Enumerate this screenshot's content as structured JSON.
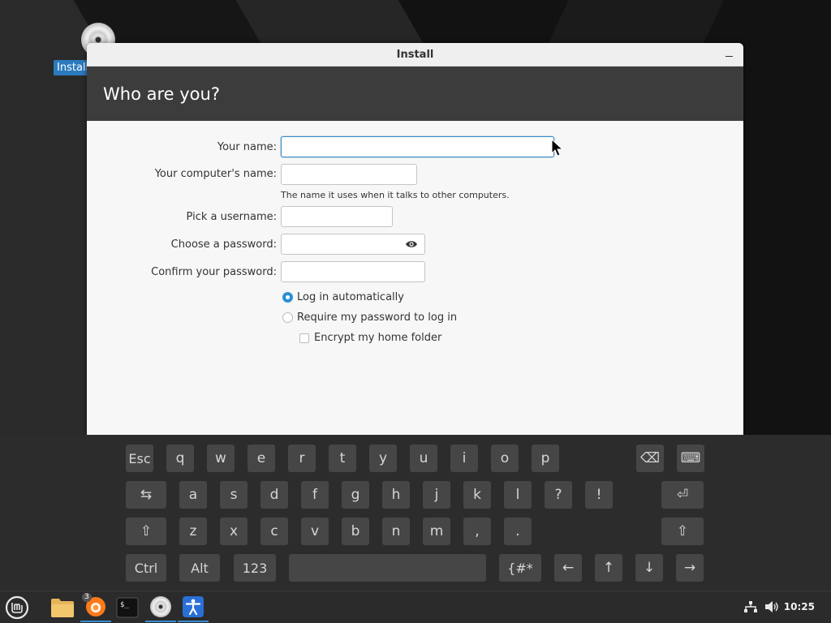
{
  "desktop": {
    "icon_label": "Install"
  },
  "window": {
    "title": "Install",
    "heading": "Who are you?"
  },
  "form": {
    "name_label": "Your name:",
    "name_value": "",
    "computer_label": "Your computer's name:",
    "computer_value": "",
    "computer_hint": "The name it uses when it talks to other computers.",
    "username_label": "Pick a username:",
    "username_value": "",
    "password_label": "Choose a password:",
    "password_value": "",
    "confirm_label": "Confirm your password:",
    "confirm_value": "",
    "login_auto_label": "Log in automatically",
    "login_auto_selected": true,
    "require_password_label": "Require my password to log in",
    "require_password_selected": false,
    "encrypt_label": "Encrypt my home folder",
    "encrypt_checked": false
  },
  "keyboard": {
    "row1": [
      "Esc",
      "q",
      "w",
      "e",
      "r",
      "t",
      "y",
      "u",
      "i",
      "o",
      "p",
      "⌫",
      "⌨"
    ],
    "row2": [
      "⇆",
      "a",
      "s",
      "d",
      "f",
      "g",
      "h",
      "j",
      "k",
      "l",
      "?",
      "!",
      "⏎"
    ],
    "row3": [
      "⇧",
      "z",
      "x",
      "c",
      "v",
      "b",
      "n",
      "m",
      ",",
      ".",
      "⇧"
    ],
    "row4": [
      "Ctrl",
      "Alt",
      "123",
      "",
      "{#*",
      "←",
      "↑",
      "↓",
      "→"
    ]
  },
  "panel": {
    "firefox_badge": "3",
    "clock": "10:25"
  },
  "colors": {
    "accent": "#2b8fd6",
    "header_bg": "#3c3c3c",
    "key_bg": "#464646",
    "panel_bg": "#2b2b2b"
  }
}
